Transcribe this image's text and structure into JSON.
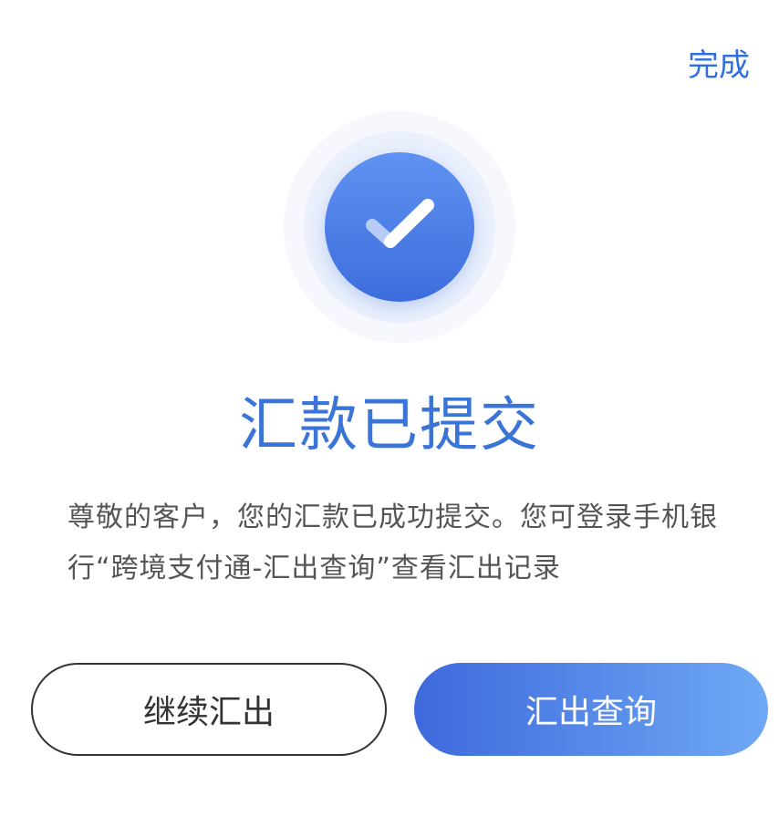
{
  "header": {
    "done_label": "完成"
  },
  "status": {
    "icon": "check-icon",
    "title": "汇款已提交",
    "message": "尊敬的客户，您的汇款已成功提交。您可登录手机银行“跨境支付通-汇出查询”查看汇出记录"
  },
  "actions": {
    "continue_label": "继续汇出",
    "query_label": "汇出查询"
  },
  "colors": {
    "accent": "#3a74d6",
    "button_gradient_start": "#3e69dc",
    "button_gradient_end": "#6ea9f5",
    "text": "#555555"
  }
}
